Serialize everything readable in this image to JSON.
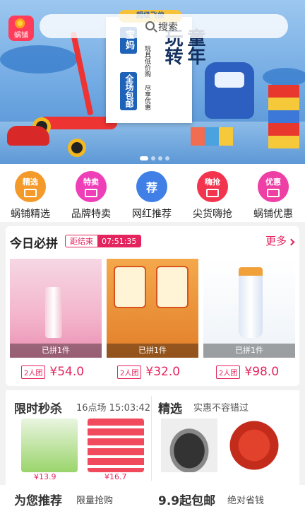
{
  "header": {
    "logo_text": "蜗铺",
    "search_placeholder": "搜索"
  },
  "banner": {
    "board_top": "超级飞侠",
    "mom_tag": "宝妈",
    "mom_tag2": "全场包邮",
    "col1": "玩具低价购",
    "col2": "尽享优惠",
    "big1": "玩转",
    "big2": "童年",
    "dots": 4,
    "active_dot": 0
  },
  "categories": [
    {
      "icon_text": "精选",
      "label": "蜗铺精选",
      "color": "#f39a2b",
      "icon": "shop-icon"
    },
    {
      "icon_text": "特卖",
      "label": "品牌特卖",
      "color": "#ee3fb8",
      "icon": "bag-icon"
    },
    {
      "icon_text": "荐",
      "label": "网红推荐",
      "color": "#3f7fe6",
      "icon": "recommend-icon"
    },
    {
      "icon_text": "嗨抢",
      "label": "尖货嗨抢",
      "color": "#f2344e",
      "icon": "diamond-icon"
    },
    {
      "icon_text": "优惠",
      "label": "蜗铺优惠",
      "color": "#ee3fa4",
      "icon": "coupon-icon"
    }
  ],
  "today": {
    "title": "今日必拼",
    "countdown_label": "距结束",
    "countdown_time": "07:51:35",
    "more": "更多",
    "products": [
      {
        "joined": "已拼1件",
        "tuan": "2人团",
        "price": "¥54.0",
        "image": "mist-spray"
      },
      {
        "joined": "已拼1件",
        "tuan": "2人团",
        "price": "¥32.0",
        "image": "snack-chips"
      },
      {
        "joined": "已拼1件",
        "tuan": "2人团",
        "price": "¥98.0",
        "image": "sunscreen-lotion"
      }
    ]
  },
  "flash": {
    "title": "限时秒杀",
    "subtitle": "16点场 15:03:42",
    "items": [
      {
        "price": "¥13.9",
        "image": "tissue-pack"
      },
      {
        "price": "¥16.7",
        "image": "tissue-stack"
      }
    ]
  },
  "choice": {
    "title": "精选",
    "subtitle": "实惠不容错过",
    "items": [
      {
        "image": "rice-cooker"
      },
      {
        "image": "instant-noodle"
      }
    ]
  },
  "bottom": {
    "left_title": "为您推荐",
    "left_sub": "限量抢购",
    "right_title": "9.9起包邮",
    "right_sub": "绝对省钱"
  }
}
